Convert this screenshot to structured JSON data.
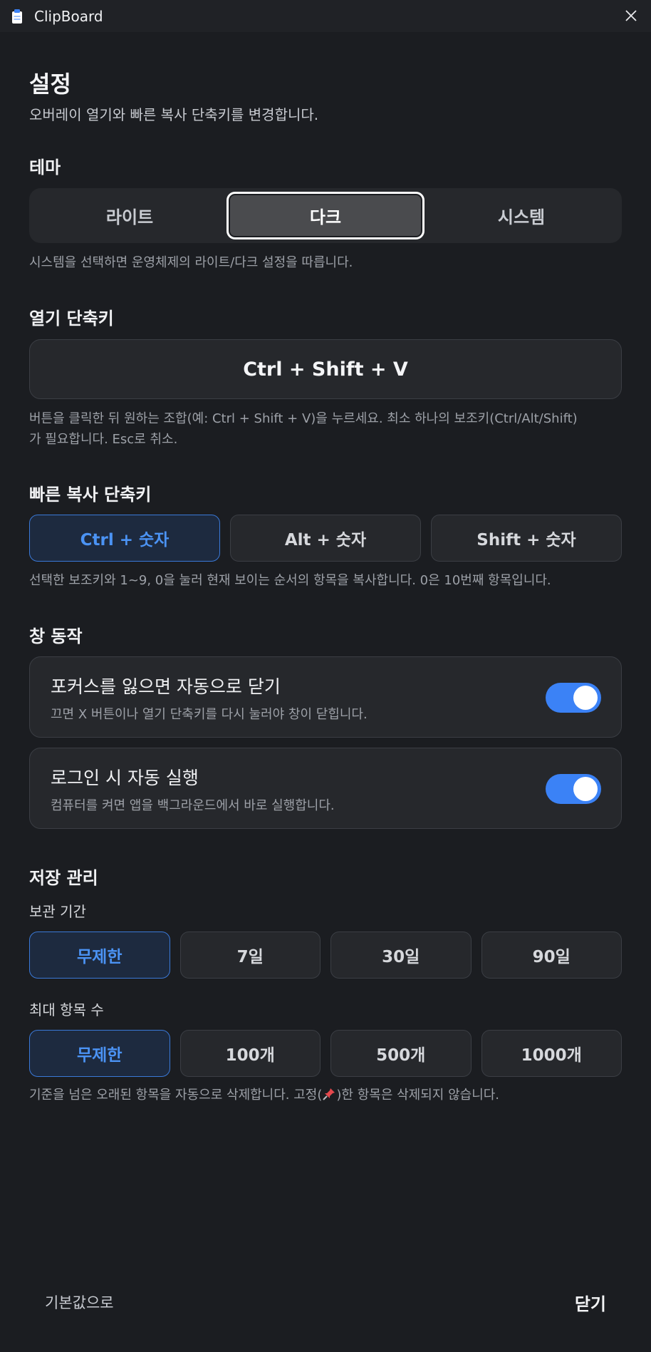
{
  "window": {
    "title": "ClipBoard"
  },
  "header": {
    "title": "설정",
    "subtitle": "오버레이 열기와 빠른 복사 단축키를 변경합니다."
  },
  "theme": {
    "title": "테마",
    "options": [
      "라이트",
      "다크",
      "시스템"
    ],
    "selected": "다크",
    "hint": "시스템을 선택하면 운영체제의 라이트/다크 설정을 따릅니다."
  },
  "open_shortcut": {
    "title": "열기 단축키",
    "value": "Ctrl + Shift + V",
    "hint_line1": "버튼을 클릭한 뒤 원하는 조합(예: Ctrl + Shift + V)을 누르세요. 최소 하나의 보조키(Ctrl/Alt/Shift)",
    "hint_line2": "가 필요합니다. Esc로 취소."
  },
  "quick_copy": {
    "title": "빠른 복사 단축키",
    "options": [
      "Ctrl + 숫자",
      "Alt + 숫자",
      "Shift + 숫자"
    ],
    "selected": "Ctrl + 숫자",
    "hint": "선택한 보조키와 1~9, 0을 눌러 현재 보이는 순서의 항목을 복사합니다. 0은 10번째 항목입니다."
  },
  "window_behavior": {
    "title": "창 동작",
    "items": [
      {
        "label": "포커스를 잃으면 자동으로 닫기",
        "desc": "끄면 X 버튼이나 열기 단축키를 다시 눌러야 창이 닫힙니다.",
        "enabled": true
      },
      {
        "label": "로그인 시 자동 실행",
        "desc": "컴퓨터를 켜면 앱을 백그라운드에서 바로 실행합니다.",
        "enabled": true
      }
    ]
  },
  "storage": {
    "title": "저장 관리",
    "retention_label": "보관 기간",
    "retention_options": [
      "무제한",
      "7일",
      "30일",
      "90일"
    ],
    "retention_selected": "무제한",
    "max_label": "최대 항목 수",
    "max_options": [
      "무제한",
      "100개",
      "500개",
      "1000개"
    ],
    "max_selected": "무제한",
    "hint_before": "기준을 넘은 오래된 항목을 자동으로 삭제합니다. 고정(",
    "hint_after": ")한 항목은 삭제되지 않습니다."
  },
  "footer": {
    "reset_label": "기본값으로",
    "close_label": "닫기"
  },
  "colors": {
    "accent": "#3b82f6",
    "background": "#1b1d21",
    "surface": "#26282c"
  },
  "icons": {
    "app": "clipboard-icon",
    "close": "close-icon",
    "pin": "pin-icon"
  }
}
